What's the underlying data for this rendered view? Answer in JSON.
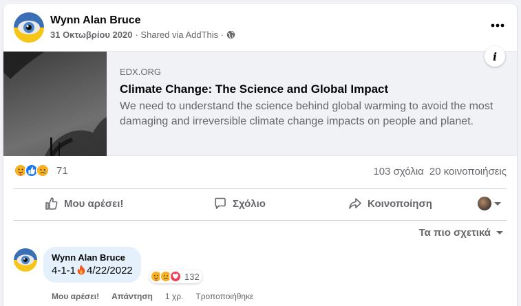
{
  "post": {
    "author": "Wynn Alan Bruce",
    "date": "31 Οκτωβρίου 2020",
    "shared_via": "· Shared via AddThis ·",
    "privacy_icon": "globe-icon",
    "more_icon": "more-icon"
  },
  "link": {
    "domain": "EDX.ORG",
    "title": "Climate Change: The Science and Global Impact",
    "description": "We need to understand the science behind global warming to avoid the most damaging and irreversible climate change impacts on people and planet.",
    "info_label": "i"
  },
  "stats": {
    "reaction_count": "71",
    "comments": "103 σχόλια",
    "shares": "20 κοινοποιήσεις",
    "reaction_colors": {
      "care": "#f7b125",
      "like": "#1877f2",
      "sad": "#f7b125"
    }
  },
  "actions": {
    "like": "Μου αρέσει!",
    "comment": "Σχόλιο",
    "share": "Κοινοποίηση"
  },
  "sort_label": "Τα πιο σχετικά",
  "comment": {
    "author": "Wynn Alan Bruce",
    "text_before": "4-1-1",
    "text_after": "4/22/2022",
    "reaction_count": "132",
    "like": "Μου αρέσει!",
    "reply": "Απάντηση",
    "time": "1 χρ.",
    "edited": "Τροποποιήθηκε"
  },
  "colors": {
    "background": "#f0f2f5",
    "card": "#ffffff",
    "secondary_text": "#65676b",
    "bubble": "#e4f0fb",
    "accent_blue": "#1877f2"
  }
}
